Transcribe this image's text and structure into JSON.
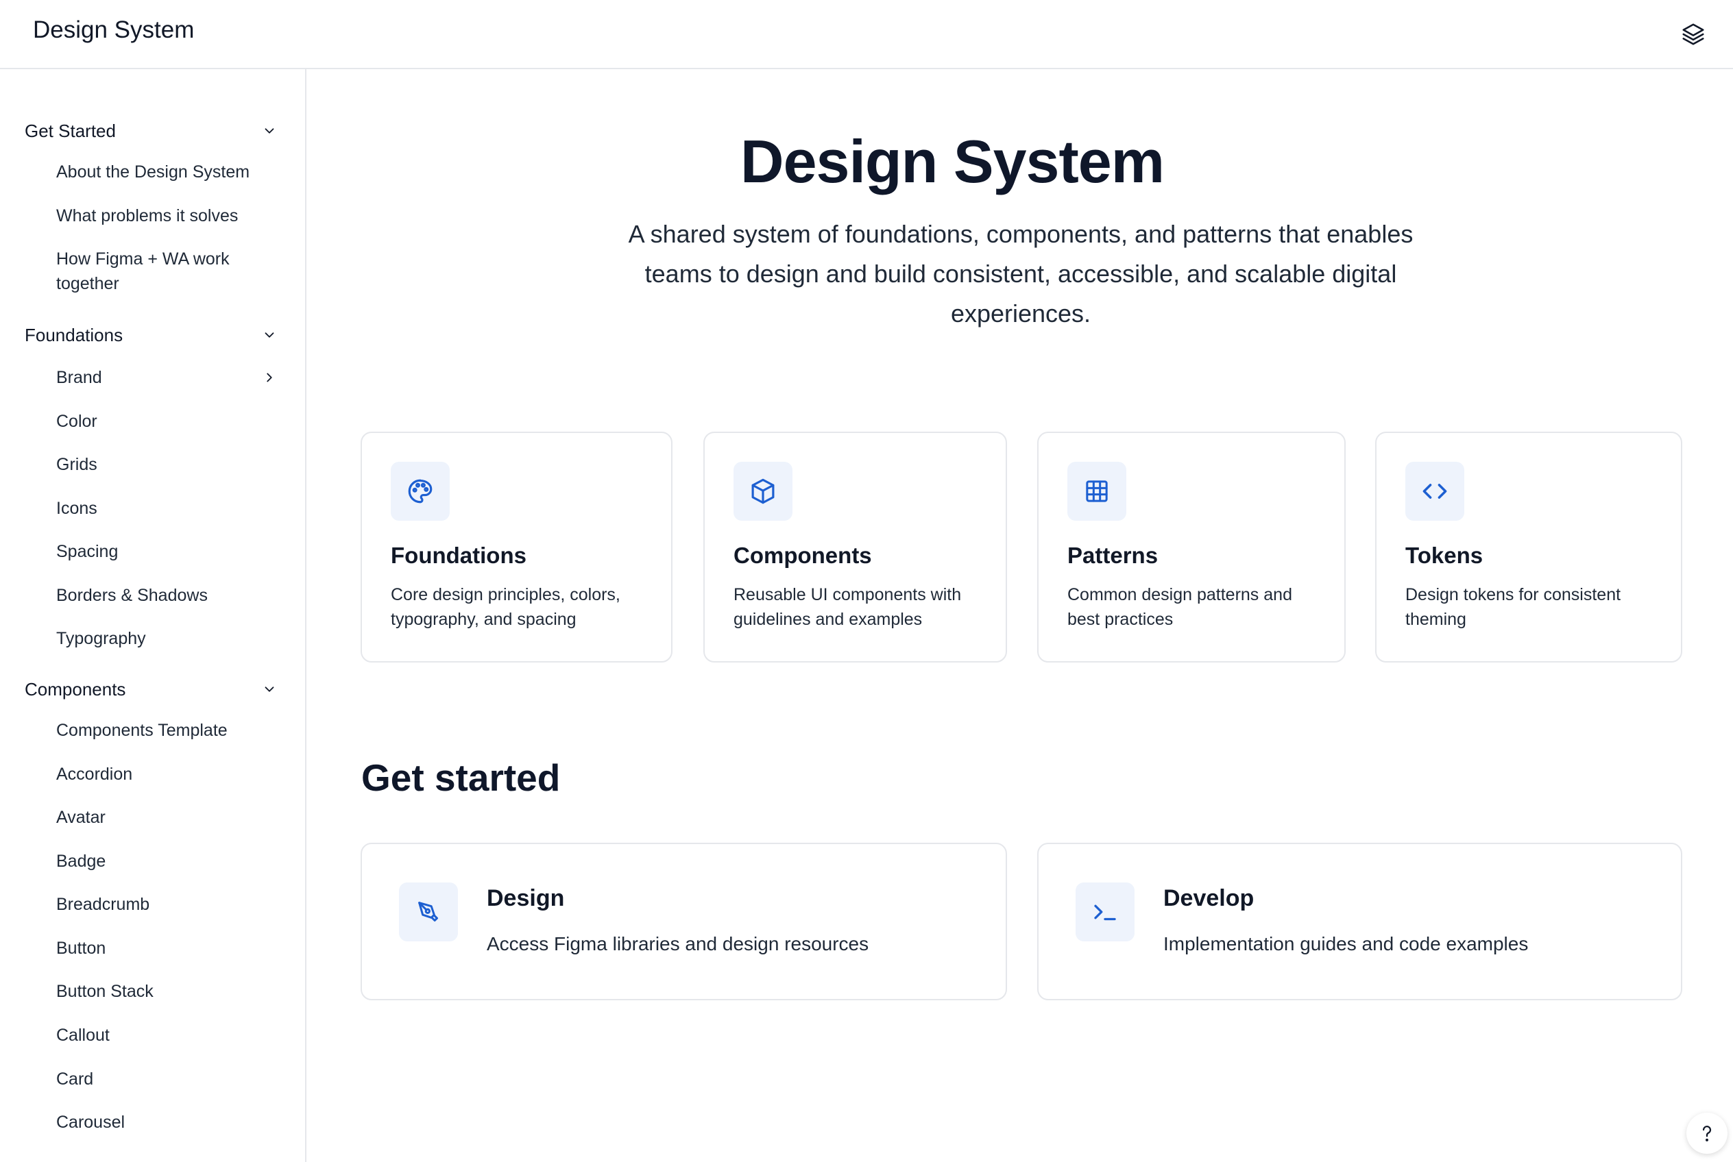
{
  "header": {
    "title": "Design System",
    "layers_icon": "layers-icon"
  },
  "sidebar": {
    "sections": [
      {
        "label": "Get Started",
        "expanded": true,
        "items": [
          {
            "label": "About the Design System"
          },
          {
            "label": "What problems it solves"
          },
          {
            "label": "How Figma + WA work together"
          }
        ]
      },
      {
        "label": "Foundations",
        "expanded": true,
        "items": [
          {
            "label": "Brand",
            "has_children": true
          },
          {
            "label": "Color"
          },
          {
            "label": "Grids"
          },
          {
            "label": "Icons"
          },
          {
            "label": "Spacing"
          },
          {
            "label": "Borders & Shadows"
          },
          {
            "label": "Typography"
          }
        ]
      },
      {
        "label": "Components",
        "expanded": true,
        "items": [
          {
            "label": "Components Template"
          },
          {
            "label": "Accordion"
          },
          {
            "label": "Avatar"
          },
          {
            "label": "Badge"
          },
          {
            "label": "Breadcrumb"
          },
          {
            "label": "Button"
          },
          {
            "label": "Button Stack"
          },
          {
            "label": "Callout"
          },
          {
            "label": "Card"
          },
          {
            "label": "Carousel"
          }
        ]
      }
    ]
  },
  "hero": {
    "title": "Design System",
    "description": "A shared system of foundations, components, and patterns that enables teams to design and build consistent, accessible, and scalable digital experiences."
  },
  "feature_cards": [
    {
      "title": "Foundations",
      "description": "Core design principles, colors, typography, and spacing",
      "icon": "palette-icon"
    },
    {
      "title": "Components",
      "description": "Reusable UI components with guidelines and examples",
      "icon": "cube-icon"
    },
    {
      "title": "Patterns",
      "description": "Common design patterns and best practices",
      "icon": "grid-icon"
    },
    {
      "title": "Tokens",
      "description": "Design tokens for consistent theming",
      "icon": "code-icon"
    }
  ],
  "get_started": {
    "title": "Get started",
    "cards": [
      {
        "title": "Design",
        "description": "Access Figma libraries and design resources",
        "icon": "pen-tool-icon"
      },
      {
        "title": "Develop",
        "description": "Implementation guides and code examples",
        "icon": "terminal-icon"
      }
    ]
  },
  "help": {
    "icon": "help-icon"
  },
  "colors": {
    "accent": "#1d5fd1",
    "icon_bg": "#eef3fc",
    "border": "#e5e7eb",
    "text": "#111827"
  }
}
